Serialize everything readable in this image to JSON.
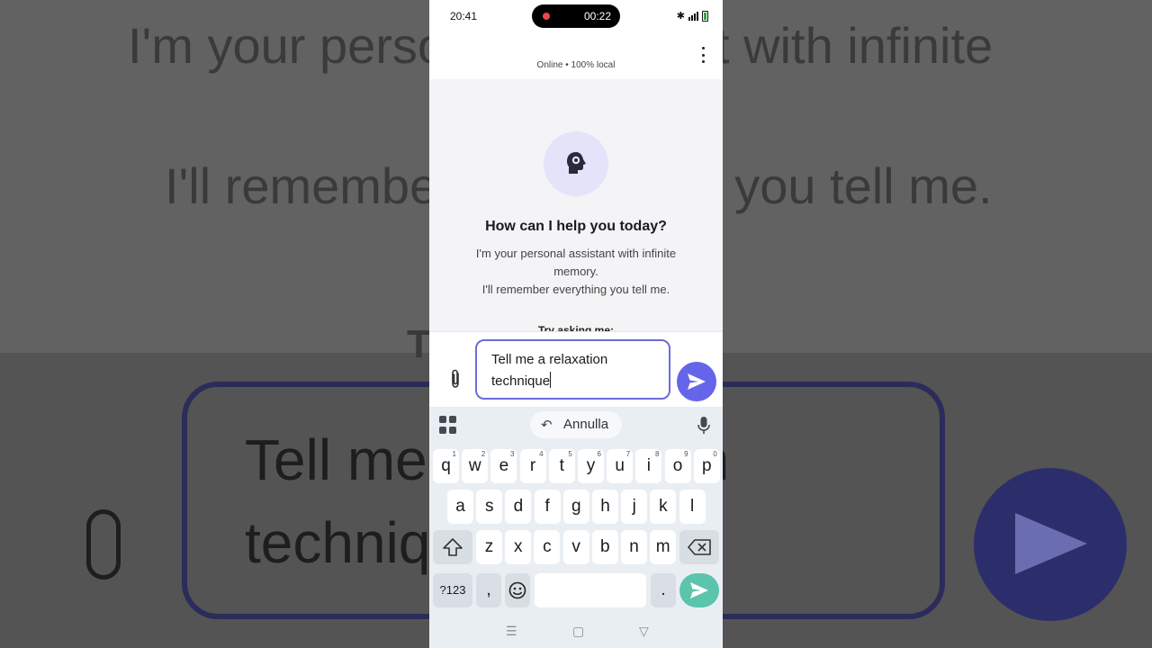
{
  "background": {
    "line1": "I'm your perso",
    "line1b": "t with infinite",
    "line2": "I'll remembe",
    "line2b": "you tell me.",
    "line3": "T",
    "input_line1": "Tell me",
    "input_line1b": "n",
    "input_line2": "techniq"
  },
  "status_bar": {
    "time": "20:41",
    "recording_time": "00:22",
    "bluetooth_icon": "bluetooth-icon",
    "signal_icon": "signal-icon",
    "battery_icon": "battery-icon"
  },
  "app_bar": {
    "status": "Online • 100% local",
    "menu_icon": "more-vert-icon"
  },
  "chat": {
    "avatar_icon": "head-gear-icon",
    "welcome_title": "How can I help you today?",
    "welcome_line1": "I'm your personal assistant with infinite memory.",
    "welcome_line2": "I'll remember everything you tell me.",
    "try_label": "Try asking me:"
  },
  "composer": {
    "attach_icon": "paperclip-icon",
    "input_value": "Tell me a relaxation technique",
    "send_icon": "send-icon"
  },
  "keyboard": {
    "toolbar": {
      "apps_icon": "apps-grid-icon",
      "undo_label": "Annulla",
      "mic_icon": "mic-icon"
    },
    "row1": [
      {
        "k": "q",
        "n": "1"
      },
      {
        "k": "w",
        "n": "2"
      },
      {
        "k": "e",
        "n": "3"
      },
      {
        "k": "r",
        "n": "4"
      },
      {
        "k": "t",
        "n": "5"
      },
      {
        "k": "y",
        "n": "6"
      },
      {
        "k": "u",
        "n": "7"
      },
      {
        "k": "i",
        "n": "8"
      },
      {
        "k": "o",
        "n": "9"
      },
      {
        "k": "p",
        "n": "0"
      }
    ],
    "row2": [
      "a",
      "s",
      "d",
      "f",
      "g",
      "h",
      "j",
      "k",
      "l"
    ],
    "row3": [
      "z",
      "x",
      "c",
      "v",
      "b",
      "n",
      "m"
    ],
    "symbols_label": "?123",
    "comma_label": ",",
    "period_label": ".",
    "emoji_icon": "emoji-icon",
    "shift_icon": "shift-icon",
    "backspace_icon": "backspace-icon",
    "enter_icon": "send-icon"
  },
  "nav_bar": {
    "recents_icon": "recents-icon",
    "home_icon": "home-icon",
    "back_icon": "back-icon"
  }
}
